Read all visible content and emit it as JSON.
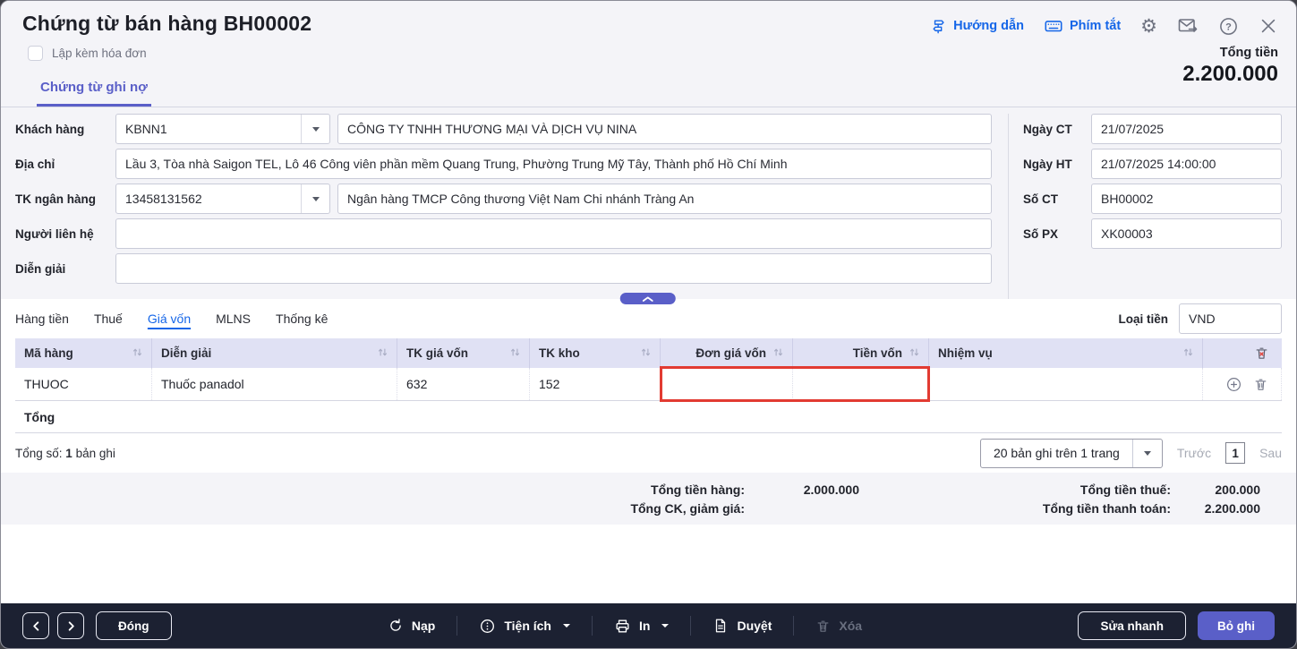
{
  "window": {
    "title": "Chứng từ bán hàng BH00002"
  },
  "header": {
    "guide_link": "Hướng dẫn",
    "shortcut_link": "Phím tắt",
    "icons": [
      "guide-icon",
      "keyboard-icon",
      "gear-icon",
      "mail-send-icon",
      "help-icon",
      "close-icon"
    ],
    "checkbox_label": "Lập kèm hóa đơn",
    "total_label": "Tổng tiền",
    "total_value": "2.200.000",
    "tab": "Chứng từ ghi nợ"
  },
  "form": {
    "left": [
      {
        "label": "Khách hàng",
        "combo": "KBNN1",
        "value": "CÔNG TY TNHH THƯƠNG MẠI VÀ DỊCH VỤ NINA"
      },
      {
        "label": "Địa chỉ",
        "value": "Lầu 3, Tòa nhà Saigon TEL, Lô 46 Công viên phần mềm Quang Trung, Phường Trung Mỹ Tây, Thành phố Hồ Chí Minh"
      },
      {
        "label": "TK ngân hàng",
        "combo": "13458131562",
        "value": "Ngân hàng TMCP Công thương Việt Nam Chi nhánh Tràng An"
      },
      {
        "label": "Người liên hệ",
        "value": ""
      },
      {
        "label": "Diễn giải",
        "value": ""
      }
    ],
    "right": [
      {
        "label": "Ngày CT",
        "value": "21/07/2025"
      },
      {
        "label": "Ngày HT",
        "value": "21/07/2025 14:00:00"
      },
      {
        "label": "Số CT",
        "value": "BH00002"
      },
      {
        "label": "Số PX",
        "value": "XK00003"
      }
    ]
  },
  "detail_tabs": {
    "items": [
      "Hàng tiền",
      "Thuế",
      "Giá vốn",
      "MLNS",
      "Thống kê"
    ],
    "active": "Giá vốn",
    "currency_label": "Loại tiền",
    "currency_value": "VND"
  },
  "table": {
    "columns": [
      "Mã hàng",
      "Diễn giải",
      "TK giá vốn",
      "TK kho",
      "Đơn giá vốn",
      "Tiền vốn",
      "Nhiệm vụ"
    ],
    "rows": [
      [
        "THUOC",
        "Thuốc panadol",
        "632",
        "152",
        "",
        "",
        ""
      ]
    ],
    "total_label": "Tổng"
  },
  "pagination": {
    "total_prefix": "Tổng số:",
    "total_count": "1",
    "total_suffix": "bản ghi",
    "page_size": "20 bản ghi trên 1 trang",
    "prev": "Trước",
    "page": "1",
    "next": "Sau"
  },
  "summary": {
    "items": [
      {
        "label": "Tổng tiền hàng:",
        "value": "2.000.000"
      },
      {
        "label": "Tổng tiền thuế:",
        "value": "200.000"
      },
      {
        "label": "Tổng CK, giảm giá:",
        "value": ""
      },
      {
        "label": "Tổng tiền thanh toán:",
        "value": "2.200.000"
      }
    ]
  },
  "footer": {
    "close": "Đóng",
    "reload": "Nạp",
    "utilities": "Tiện ích",
    "print": "In",
    "approve": "Duyệt",
    "delete": "Xóa",
    "quick_edit": "Sửa nhanh",
    "unpost": "Bỏ ghi"
  },
  "colors": {
    "accent": "#5a5fc8",
    "link": "#1566e8",
    "error": "#e23b32",
    "footer_bg": "#1c2132",
    "head_bg": "#f4f4f8",
    "th_bg": "#e0e1f4"
  }
}
